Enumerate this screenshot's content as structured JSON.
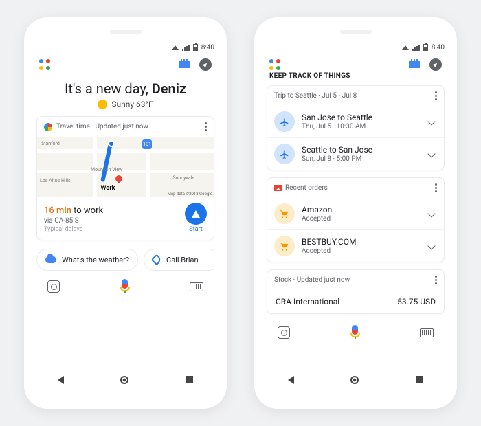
{
  "status": {
    "time": "8:40"
  },
  "left": {
    "greeting_prefix": "It's a new day, ",
    "greeting_name": "Deniz",
    "weather": "Sunny 63°F",
    "travel_card": {
      "header": "Travel time · Updated just now",
      "map": {
        "hwy": "101",
        "labels": [
          "Stanford",
          "Mountain View",
          "Los Altos Hills",
          "Sunnyvale"
        ],
        "dest_label": "Work",
        "attribution": "Map data ©2018 Google"
      },
      "eta_time": "16 min",
      "eta_suffix": " to work",
      "via": "via CA-85 S",
      "delays": "Typical delays",
      "start": "Start"
    },
    "chips": [
      {
        "icon": "cloud",
        "label": "What's the weather?"
      },
      {
        "icon": "phone",
        "label": "Call Brian"
      }
    ]
  },
  "right": {
    "section": "KEEP TRACK OF THINGS",
    "trip": {
      "header": "Trip to Seattle · Jul 5 - Jul 8",
      "flights": [
        {
          "title": "San Jose to Seattle",
          "sub": "Thu, Jul 5 · 10:30 AM"
        },
        {
          "title": "Seattle to San Jose",
          "sub": "Sun, Jul 8 · 5:00 PM"
        }
      ]
    },
    "orders": {
      "header": "Recent orders",
      "items": [
        {
          "title": "Amazon",
          "sub": "Accepted"
        },
        {
          "title": "BESTBUY.COM",
          "sub": "Accepted"
        }
      ]
    },
    "stock": {
      "header": "Stock · Updated just now",
      "name": "CRA International",
      "price": "53.75 USD"
    }
  }
}
